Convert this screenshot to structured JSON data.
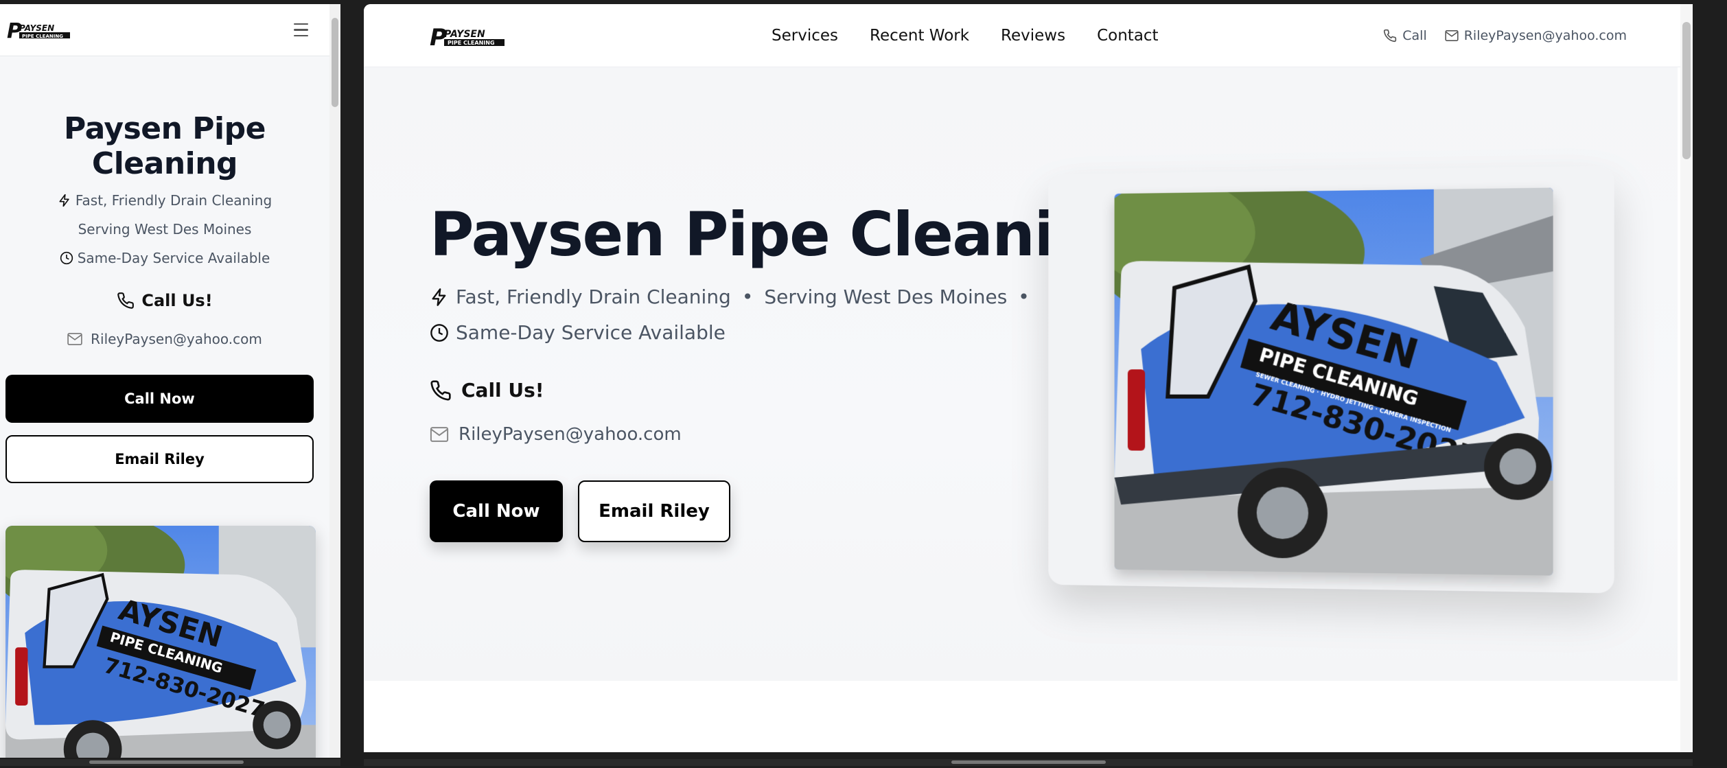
{
  "brand": {
    "logo_text": "PAYSEN",
    "logo_sub": "PIPE CLEANING"
  },
  "mobile": {
    "title": "Paysen Pipe Cleaning",
    "tagline_1": "Fast, Friendly Drain Cleaning",
    "tagline_2": "Serving West Des Moines",
    "tagline_3": "Same-Day Service Available",
    "call_label": "Call Us!",
    "email": "RileyPaysen@yahoo.com",
    "call_button": "Call Now",
    "email_button": "Email Riley"
  },
  "desktop": {
    "nav": [
      "Services",
      "Recent Work",
      "Reviews",
      "Contact"
    ],
    "nav_call": "Call",
    "nav_email": "RileyPaysen@yahoo.com",
    "title": "Paysen Pipe Cleaning",
    "tagline_1": "Fast, Friendly Drain Cleaning",
    "tagline_2": "Serving West Des Moines",
    "tagline_3": "Same-Day Service Available",
    "separator": "•",
    "call_label": "Call Us!",
    "email": "RileyPaysen@yahoo.com",
    "call_button": "Call Now",
    "email_button": "Email Riley"
  },
  "van": {
    "brand_big": "AYSEN",
    "brand_sub": "PIPE CLEANING",
    "services": "SEWER CLEANING · HYDRO JETTING · CAMERA INSPECTION",
    "phone": "712-830-2027"
  },
  "colors": {
    "accent": "#000000",
    "van_blue": "#3b6fd1",
    "sky": "#5c8ee6"
  }
}
